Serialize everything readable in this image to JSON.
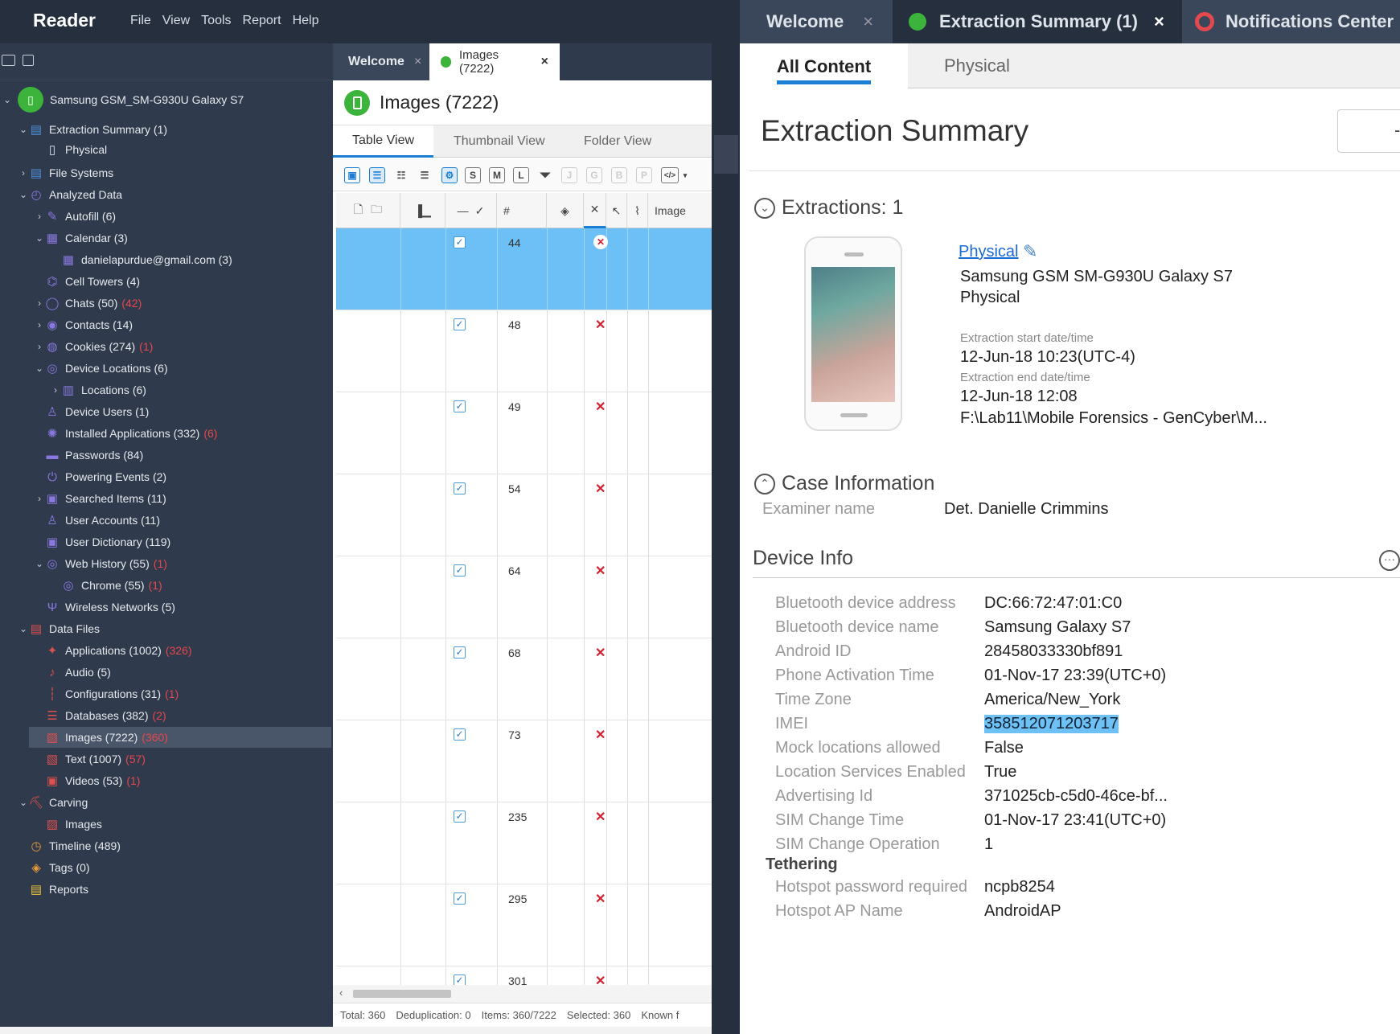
{
  "app": {
    "title": "Reader",
    "menu": [
      "File",
      "View",
      "Tools",
      "Report",
      "Help"
    ]
  },
  "tree": [
    {
      "label": "Samsung GSM_SM-G930U Galaxy S7",
      "chev": "⌄",
      "icon": "device-icon",
      "color": "#3cb43c"
    },
    {
      "label": "Extraction Summary (1)",
      "chev": "⌄",
      "icon": "summary-icon",
      "color": "#4d8fd8"
    },
    {
      "label": "Physical",
      "chev": "",
      "icon": "phone-icon",
      "color": "#dfe4ea"
    },
    {
      "label": "File Systems",
      "chev": "›",
      "icon": "filesystem-icon",
      "color": "#4d8fd8"
    },
    {
      "label": "Analyzed Data",
      "chev": "⌄",
      "icon": "analyzed-icon",
      "color": "#8a78e0"
    },
    {
      "label": "Autofill (6)",
      "chev": "›",
      "icon": "autofill-icon",
      "color": "#8a78e0"
    },
    {
      "label": "Calendar (3)",
      "chev": "⌄",
      "icon": "calendar-icon",
      "color": "#8a78e0"
    },
    {
      "label": "danielapurdue@gmail.com (3)",
      "chev": "",
      "icon": "calendar-icon",
      "color": "#8a78e0"
    },
    {
      "label": "Cell Towers (4)",
      "chev": "",
      "icon": "tower-icon",
      "color": "#8a78e0"
    },
    {
      "label": "Chats (50)",
      "red": "(42)",
      "chev": "›",
      "icon": "chat-icon",
      "color": "#8a78e0"
    },
    {
      "label": "Contacts (14)",
      "chev": "›",
      "icon": "contact-icon",
      "color": "#8a78e0"
    },
    {
      "label": "Cookies (274)",
      "red": "(1)",
      "chev": "›",
      "icon": "cookie-icon",
      "color": "#8a78e0"
    },
    {
      "label": "Device Locations (6)",
      "chev": "⌄",
      "icon": "globe-icon",
      "color": "#8a78e0"
    },
    {
      "label": "Locations (6)",
      "chev": "›",
      "icon": "map-icon",
      "color": "#8a78e0"
    },
    {
      "label": "Device Users (1)",
      "chev": "",
      "icon": "user-icon",
      "color": "#8a78e0"
    },
    {
      "label": "Installed Applications (332)",
      "red": "(6)",
      "chev": "",
      "icon": "apps-icon",
      "color": "#8a78e0"
    },
    {
      "label": "Passwords (84)",
      "chev": "",
      "icon": "password-icon",
      "color": "#8a78e0"
    },
    {
      "label": "Powering Events (2)",
      "chev": "",
      "icon": "power-icon",
      "color": "#8a78e0"
    },
    {
      "label": "Searched Items (11)",
      "chev": "›",
      "icon": "search-icon",
      "color": "#8a78e0"
    },
    {
      "label": "User Accounts (11)",
      "chev": "",
      "icon": "account-icon",
      "color": "#8a78e0"
    },
    {
      "label": "User Dictionary (119)",
      "chev": "",
      "icon": "dictionary-icon",
      "color": "#8a78e0"
    },
    {
      "label": "Web History (55)",
      "red": "(1)",
      "chev": "⌄",
      "icon": "globe-icon",
      "color": "#8a78e0"
    },
    {
      "label": "Chrome (55)",
      "red": "(1)",
      "chev": "",
      "icon": "globe-icon",
      "color": "#8a78e0"
    },
    {
      "label": "Wireless Networks (5)",
      "chev": "",
      "icon": "wifi-icon",
      "color": "#8a78e0"
    },
    {
      "label": "Data Files",
      "chev": "⌄",
      "icon": "datafiles-icon",
      "color": "#e05050"
    },
    {
      "label": "Applications (1002)",
      "red": "(326)",
      "chev": "",
      "icon": "app-icon",
      "color": "#e05050"
    },
    {
      "label": "Audio (5)",
      "chev": "",
      "icon": "audio-icon",
      "color": "#e05050"
    },
    {
      "label": "Configurations (31)",
      "red": "(1)",
      "chev": "",
      "icon": "config-icon",
      "color": "#e05050"
    },
    {
      "label": "Databases (382)",
      "red": "(2)",
      "chev": "",
      "icon": "database-icon",
      "color": "#e05050"
    },
    {
      "label": "Images (7222)",
      "red": "(360)",
      "chev": "",
      "icon": "image-icon",
      "color": "#e05050",
      "selected": true
    },
    {
      "label": "Text (1007)",
      "red": "(57)",
      "chev": "",
      "icon": "text-icon",
      "color": "#e05050"
    },
    {
      "label": "Videos (53)",
      "red": "(1)",
      "chev": "",
      "icon": "video-icon",
      "color": "#e05050"
    },
    {
      "label": "Carving",
      "chev": "⌄",
      "icon": "carving-icon",
      "color": "#e05050"
    },
    {
      "label": "Images",
      "chev": "",
      "icon": "image-icon",
      "color": "#e05050"
    },
    {
      "label": "Timeline (489)",
      "chev": "",
      "icon": "clock-icon",
      "color": "#e89b3a"
    },
    {
      "label": "Tags (0)",
      "chev": "",
      "icon": "tag-icon",
      "color": "#e89b3a"
    },
    {
      "label": "Reports",
      "chev": "",
      "icon": "report-icon",
      "color": "#e8c03a"
    }
  ],
  "center": {
    "tabs": {
      "welcome": "Welcome",
      "images": "Images (7222)"
    },
    "title": "Images (7222)",
    "view_tabs": [
      "Table View",
      "Thumbnail View",
      "Folder View"
    ],
    "tool_letters": [
      "S",
      "M",
      "L",
      "J",
      "G",
      "B",
      "P"
    ],
    "col_headers": {
      "num": "#",
      "image": "Image"
    },
    "rows": [
      "44",
      "48",
      "49",
      "54",
      "64",
      "68",
      "73",
      "235",
      "295",
      "301"
    ],
    "status": [
      "Total: 360",
      "Deduplication: 0",
      "Items: 360/7222",
      "Selected: 360",
      "Known f"
    ]
  },
  "right": {
    "tabs": {
      "welcome": "Welcome",
      "summary": "Extraction Summary (1)",
      "notifications": "Notifications Center"
    },
    "subtabs": [
      "All Content",
      "Physical"
    ],
    "title": "Extraction Summary",
    "extractions_header": "Extractions: 1",
    "ext": {
      "link": "Physical",
      "device": "Samsung GSM SM-G930U Galaxy S7",
      "type": "Physical",
      "start_label": "Extraction start date/time",
      "start": "12-Jun-18 10:23(UTC-4)",
      "end_label": "Extraction end date/time",
      "end": "12-Jun-18 12:08",
      "path": "F:\\Lab11\\Mobile Forensics - GenCyber\\M..."
    },
    "case_header": "Case Information",
    "examiner_label": "Examiner name",
    "examiner": "Det. Danielle Crimmins",
    "device_info_header": "Device Info",
    "device_info": [
      {
        "k": "Bluetooth device address",
        "v": "DC:66:72:47:01:C0"
      },
      {
        "k": "Bluetooth device name",
        "v": "Samsung Galaxy S7"
      },
      {
        "k": "Android ID",
        "v": "28458033330bf891"
      },
      {
        "k": "Phone Activation Time",
        "v": "01-Nov-17 23:39(UTC+0)"
      },
      {
        "k": "Time Zone",
        "v": "America/New_York"
      },
      {
        "k": "IMEI",
        "v": "358512071203717",
        "highlight": true
      },
      {
        "k": "Mock locations allowed",
        "v": "False"
      },
      {
        "k": "Location Services Enabled",
        "v": "True"
      },
      {
        "k": "Advertising Id",
        "v": "371025cb-c5d0-46ce-bf..."
      },
      {
        "k": "SIM Change Time",
        "v": "01-Nov-17 23:41(UTC+0)"
      },
      {
        "k": "SIM Change Operation",
        "v": "1"
      }
    ],
    "tethering_header": "Tethering",
    "tethering": [
      {
        "k": "Hotspot password required",
        "v": "ncpb8254"
      },
      {
        "k": "Hotspot AP Name",
        "v": "AndroidAP"
      }
    ]
  },
  "colors": {
    "dark_bg": "#252f3e",
    "sidebar_bg": "#2f3a4c",
    "selection": "#6cc0f5",
    "accent": "#1a7fd4",
    "red": "#e5484d",
    "green": "#3cb43c"
  }
}
